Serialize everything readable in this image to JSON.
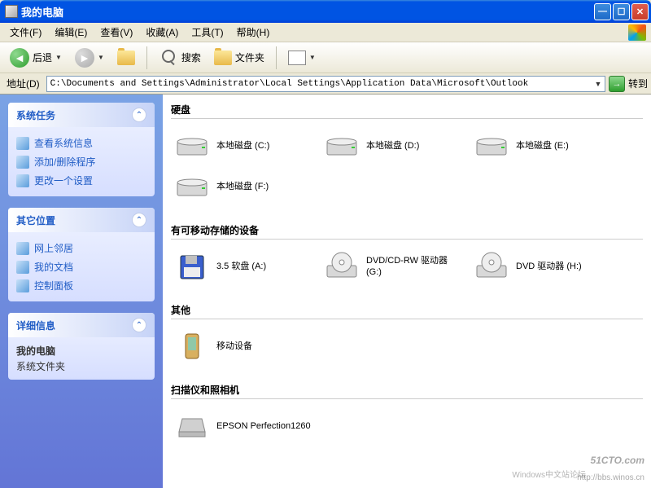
{
  "window": {
    "title": "我的电脑"
  },
  "menus": {
    "file": "文件(F)",
    "edit": "编辑(E)",
    "view": "查看(V)",
    "favorites": "收藏(A)",
    "tools": "工具(T)",
    "help": "帮助(H)"
  },
  "toolbar": {
    "back": "后退",
    "search": "搜索",
    "folders": "文件夹"
  },
  "addressbar": {
    "label": "地址(D)",
    "path": "C:\\Documents and Settings\\Administrator\\Local Settings\\Application Data\\Microsoft\\Outlook",
    "go": "转到"
  },
  "sidebar": {
    "tasks": {
      "header": "系统任务",
      "items": [
        "查看系统信息",
        "添加/删除程序",
        "更改一个设置"
      ]
    },
    "places": {
      "header": "其它位置",
      "items": [
        "网上邻居",
        "我的文档",
        "控制面板"
      ]
    },
    "details": {
      "header": "详细信息",
      "title": "我的电脑",
      "subtitle": "系统文件夹"
    }
  },
  "groups": [
    {
      "header": "硬盘",
      "items": [
        {
          "label": "本地磁盘 (C:)",
          "kind": "hdd"
        },
        {
          "label": "本地磁盘 (D:)",
          "kind": "hdd"
        },
        {
          "label": "本地磁盘 (E:)",
          "kind": "hdd"
        },
        {
          "label": "本地磁盘 (F:)",
          "kind": "hdd"
        }
      ]
    },
    {
      "header": "有可移动存储的设备",
      "items": [
        {
          "label": "3.5 软盘 (A:)",
          "kind": "floppy"
        },
        {
          "label": "DVD/CD-RW 驱动器 (G:)",
          "kind": "optical"
        },
        {
          "label": "DVD 驱动器 (H:)",
          "kind": "optical"
        }
      ]
    },
    {
      "header": "其他",
      "items": [
        {
          "label": "移动设备",
          "kind": "pda"
        }
      ]
    },
    {
      "header": "扫描仪和照相机",
      "items": [
        {
          "label": "EPSON Perfection1260",
          "kind": "scanner"
        }
      ]
    }
  ],
  "watermark": {
    "main": "51CTO.com",
    "sub": "http://bbs.winos.cn"
  },
  "watermark2": "Windows中文站论坛"
}
